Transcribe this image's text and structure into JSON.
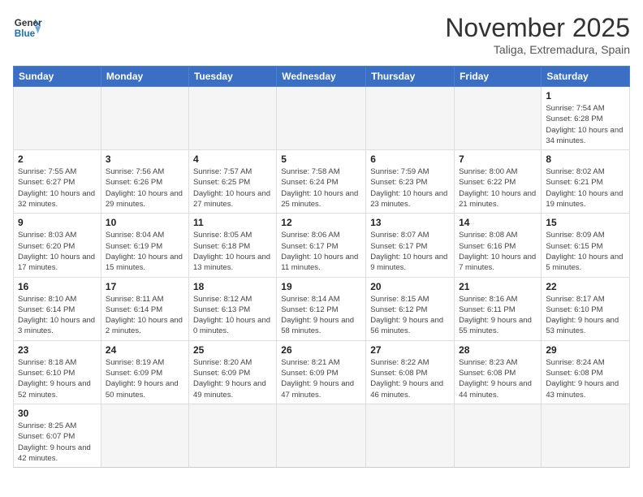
{
  "header": {
    "logo_line1": "General",
    "logo_line2": "Blue",
    "month_year": "November 2025",
    "location": "Taliga, Extremadura, Spain"
  },
  "weekdays": [
    "Sunday",
    "Monday",
    "Tuesday",
    "Wednesday",
    "Thursday",
    "Friday",
    "Saturday"
  ],
  "weeks": [
    [
      {
        "day": "",
        "info": ""
      },
      {
        "day": "",
        "info": ""
      },
      {
        "day": "",
        "info": ""
      },
      {
        "day": "",
        "info": ""
      },
      {
        "day": "",
        "info": ""
      },
      {
        "day": "",
        "info": ""
      },
      {
        "day": "1",
        "info": "Sunrise: 7:54 AM\nSunset: 6:28 PM\nDaylight: 10 hours and 34 minutes."
      }
    ],
    [
      {
        "day": "2",
        "info": "Sunrise: 7:55 AM\nSunset: 6:27 PM\nDaylight: 10 hours and 32 minutes."
      },
      {
        "day": "3",
        "info": "Sunrise: 7:56 AM\nSunset: 6:26 PM\nDaylight: 10 hours and 29 minutes."
      },
      {
        "day": "4",
        "info": "Sunrise: 7:57 AM\nSunset: 6:25 PM\nDaylight: 10 hours and 27 minutes."
      },
      {
        "day": "5",
        "info": "Sunrise: 7:58 AM\nSunset: 6:24 PM\nDaylight: 10 hours and 25 minutes."
      },
      {
        "day": "6",
        "info": "Sunrise: 7:59 AM\nSunset: 6:23 PM\nDaylight: 10 hours and 23 minutes."
      },
      {
        "day": "7",
        "info": "Sunrise: 8:00 AM\nSunset: 6:22 PM\nDaylight: 10 hours and 21 minutes."
      },
      {
        "day": "8",
        "info": "Sunrise: 8:02 AM\nSunset: 6:21 PM\nDaylight: 10 hours and 19 minutes."
      }
    ],
    [
      {
        "day": "9",
        "info": "Sunrise: 8:03 AM\nSunset: 6:20 PM\nDaylight: 10 hours and 17 minutes."
      },
      {
        "day": "10",
        "info": "Sunrise: 8:04 AM\nSunset: 6:19 PM\nDaylight: 10 hours and 15 minutes."
      },
      {
        "day": "11",
        "info": "Sunrise: 8:05 AM\nSunset: 6:18 PM\nDaylight: 10 hours and 13 minutes."
      },
      {
        "day": "12",
        "info": "Sunrise: 8:06 AM\nSunset: 6:17 PM\nDaylight: 10 hours and 11 minutes."
      },
      {
        "day": "13",
        "info": "Sunrise: 8:07 AM\nSunset: 6:17 PM\nDaylight: 10 hours and 9 minutes."
      },
      {
        "day": "14",
        "info": "Sunrise: 8:08 AM\nSunset: 6:16 PM\nDaylight: 10 hours and 7 minutes."
      },
      {
        "day": "15",
        "info": "Sunrise: 8:09 AM\nSunset: 6:15 PM\nDaylight: 10 hours and 5 minutes."
      }
    ],
    [
      {
        "day": "16",
        "info": "Sunrise: 8:10 AM\nSunset: 6:14 PM\nDaylight: 10 hours and 3 minutes."
      },
      {
        "day": "17",
        "info": "Sunrise: 8:11 AM\nSunset: 6:14 PM\nDaylight: 10 hours and 2 minutes."
      },
      {
        "day": "18",
        "info": "Sunrise: 8:12 AM\nSunset: 6:13 PM\nDaylight: 10 hours and 0 minutes."
      },
      {
        "day": "19",
        "info": "Sunrise: 8:14 AM\nSunset: 6:12 PM\nDaylight: 9 hours and 58 minutes."
      },
      {
        "day": "20",
        "info": "Sunrise: 8:15 AM\nSunset: 6:12 PM\nDaylight: 9 hours and 56 minutes."
      },
      {
        "day": "21",
        "info": "Sunrise: 8:16 AM\nSunset: 6:11 PM\nDaylight: 9 hours and 55 minutes."
      },
      {
        "day": "22",
        "info": "Sunrise: 8:17 AM\nSunset: 6:10 PM\nDaylight: 9 hours and 53 minutes."
      }
    ],
    [
      {
        "day": "23",
        "info": "Sunrise: 8:18 AM\nSunset: 6:10 PM\nDaylight: 9 hours and 52 minutes."
      },
      {
        "day": "24",
        "info": "Sunrise: 8:19 AM\nSunset: 6:09 PM\nDaylight: 9 hours and 50 minutes."
      },
      {
        "day": "25",
        "info": "Sunrise: 8:20 AM\nSunset: 6:09 PM\nDaylight: 9 hours and 49 minutes."
      },
      {
        "day": "26",
        "info": "Sunrise: 8:21 AM\nSunset: 6:09 PM\nDaylight: 9 hours and 47 minutes."
      },
      {
        "day": "27",
        "info": "Sunrise: 8:22 AM\nSunset: 6:08 PM\nDaylight: 9 hours and 46 minutes."
      },
      {
        "day": "28",
        "info": "Sunrise: 8:23 AM\nSunset: 6:08 PM\nDaylight: 9 hours and 44 minutes."
      },
      {
        "day": "29",
        "info": "Sunrise: 8:24 AM\nSunset: 6:08 PM\nDaylight: 9 hours and 43 minutes."
      }
    ],
    [
      {
        "day": "30",
        "info": "Sunrise: 8:25 AM\nSunset: 6:07 PM\nDaylight: 9 hours and 42 minutes."
      },
      {
        "day": "",
        "info": ""
      },
      {
        "day": "",
        "info": ""
      },
      {
        "day": "",
        "info": ""
      },
      {
        "day": "",
        "info": ""
      },
      {
        "day": "",
        "info": ""
      },
      {
        "day": "",
        "info": ""
      }
    ]
  ]
}
